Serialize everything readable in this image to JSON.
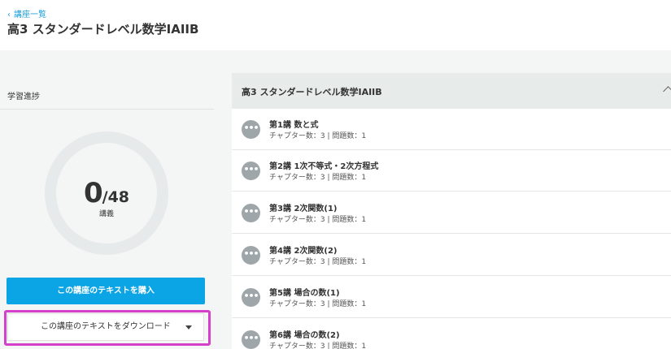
{
  "header": {
    "back_label": "講座一覧",
    "title": "高3 スタンダードレベル数学IAIIB"
  },
  "progress": {
    "label": "学習進捗",
    "done": "0",
    "total": "/48",
    "unit": "講義"
  },
  "buttons": {
    "buy": "この講座のテキストを購入",
    "download": "この講座のテキストをダウンロード"
  },
  "course": {
    "title": "高3 スタンダードレベル数学IAIIB",
    "lectures": [
      {
        "title": "第1講 数と式",
        "meta": "チャプター数：3 | 問題数：1"
      },
      {
        "title": "第2講 1次不等式・2次方程式",
        "meta": "チャプター数：3 | 問題数：1"
      },
      {
        "title": "第3講 2次関数(1)",
        "meta": "チャプター数：3 | 問題数：1"
      },
      {
        "title": "第4講 2次関数(2)",
        "meta": "チャプター数：3 | 問題数：1"
      },
      {
        "title": "第5講 場合の数(1)",
        "meta": "チャプター数：3 | 問題数：1"
      },
      {
        "title": "第6講 場合の数(2)",
        "meta": "チャプター数：3 | 問題数：1"
      }
    ]
  },
  "colors": {
    "accent": "#0ba4e4",
    "highlight": "#d63fc9"
  }
}
